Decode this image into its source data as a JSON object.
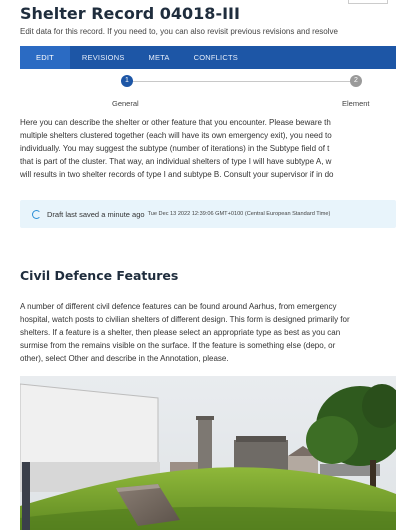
{
  "page": {
    "title": "Shelter Record 04018-III",
    "subtitle": "Edit data for this record. If you need to, you can also revisit previous revisions and resolve"
  },
  "tabs": [
    {
      "label": "EDIT",
      "active": true
    },
    {
      "label": "REVISIONS",
      "active": false
    },
    {
      "label": "META",
      "active": false
    },
    {
      "label": "CONFLICTS",
      "active": false
    }
  ],
  "stepper": {
    "steps": [
      {
        "number": "1",
        "label": "General",
        "state": "current"
      },
      {
        "number": "2",
        "label": "Element",
        "state": "upcoming"
      }
    ]
  },
  "intro_lines": [
    "Here you can describe the shelter or other feature that you encounter. Please beware th",
    "multiple shelters clustered together (each will have its own emergency exit), you need to",
    "individually. You may suggest the subtype (number of iterations) in the Subtype field of t",
    "that is part of the cluster. That way, an individual shelters of type I will have subtype A, w",
    "will results in two shelter records of type I and subtype B. Consult your supervisor if in do"
  ],
  "draft": {
    "text": "Draft last saved a minute ago",
    "timestamp": "Tue Dec 13 2022 12:39:06 GMT+0100 (Central European Standard Time)"
  },
  "section": {
    "heading": "Civil Defence Features",
    "lines": [
      "A number of different civil defence features can be found around Aarhus, from emergency",
      "hospital, watch posts to civilian shelters of different design. This form is designed primarily for",
      "shelters. If a feature is a shelter, then please select an appropriate type as best as you can",
      "surmise from the remains visible on the surface. If the feature is something else (depo, or",
      "other), select Other and describe in the Annotation, please."
    ]
  },
  "colors": {
    "tab_bar": "#1d56a6",
    "tab_active": "#2b6bc3",
    "step_current": "#1d56a6",
    "step_upcoming": "#9a9a9a",
    "draft_bg": "#e8f4fb",
    "spinner": "#2d8fd6"
  },
  "icons": {
    "draft_status": "loading-spinner-icon"
  }
}
